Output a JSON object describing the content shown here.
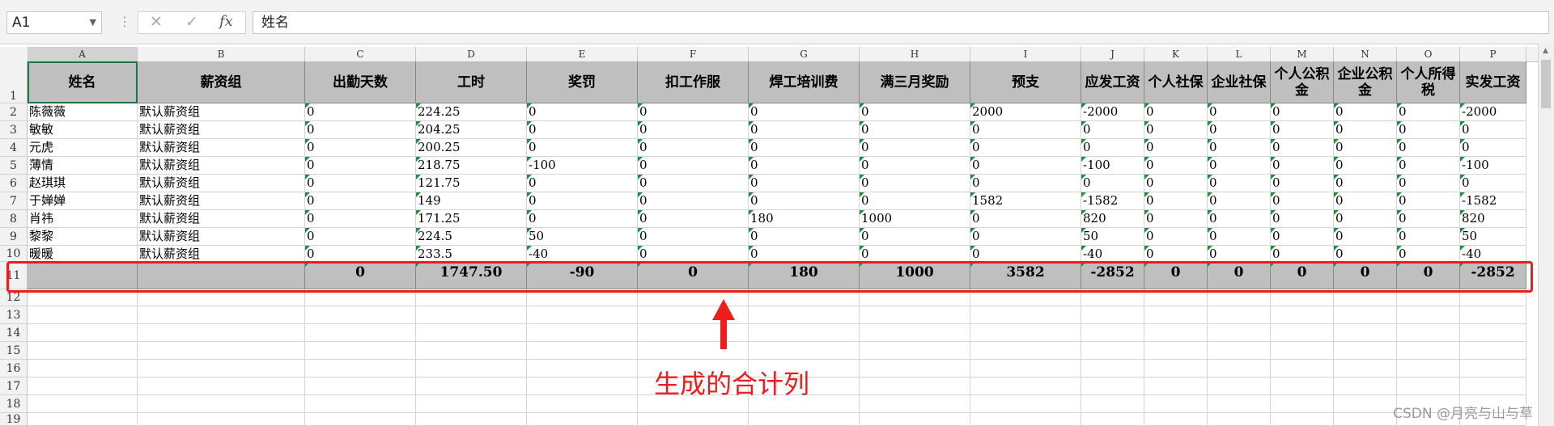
{
  "formula_bar": {
    "name_box": "A1",
    "cancel_icon": "✕",
    "enter_icon": "✓",
    "fx_label": "fx",
    "content": "姓名"
  },
  "columns": [
    "A",
    "B",
    "C",
    "D",
    "E",
    "F",
    "G",
    "H",
    "I",
    "J",
    "K",
    "L",
    "M",
    "N",
    "O",
    "P"
  ],
  "header_row": [
    "姓名",
    "薪资组",
    "出勤天数",
    "工时",
    "奖罚",
    "扣工作服",
    "焊工培训费",
    "满三月奖励",
    "预支",
    "应发工资",
    "个人社保",
    "企业社保",
    "个人公积金",
    "企业公积金",
    "个人所得税",
    "实发工资"
  ],
  "data_rows": [
    [
      "陈薇薇",
      "默认薪资组",
      "0",
      "224.25",
      "0",
      "0",
      "0",
      "0",
      "2000",
      "-2000",
      "0",
      "0",
      "0",
      "0",
      "0",
      "-2000"
    ],
    [
      "敏敏",
      "默认薪资组",
      "0",
      "204.25",
      "0",
      "0",
      "0",
      "0",
      "0",
      "0",
      "0",
      "0",
      "0",
      "0",
      "0",
      "0"
    ],
    [
      "元虎",
      "默认薪资组",
      "0",
      "200.25",
      "0",
      "0",
      "0",
      "0",
      "0",
      "0",
      "0",
      "0",
      "0",
      "0",
      "0",
      "0"
    ],
    [
      "薄情",
      "默认薪资组",
      "0",
      "218.75",
      "-100",
      "0",
      "0",
      "0",
      "0",
      "-100",
      "0",
      "0",
      "0",
      "0",
      "0",
      "-100"
    ],
    [
      "赵琪琪",
      "默认薪资组",
      "0",
      "121.75",
      "0",
      "0",
      "0",
      "0",
      "0",
      "0",
      "0",
      "0",
      "0",
      "0",
      "0",
      "0"
    ],
    [
      "于婵婵",
      "默认薪资组",
      "0",
      "149",
      "0",
      "0",
      "0",
      "0",
      "1582",
      "-1582",
      "0",
      "0",
      "0",
      "0",
      "0",
      "-1582"
    ],
    [
      "肖祎",
      "默认薪资组",
      "0",
      "171.25",
      "0",
      "0",
      "180",
      "1000",
      "0",
      "820",
      "0",
      "0",
      "0",
      "0",
      "0",
      "820"
    ],
    [
      "黎黎",
      "默认薪资组",
      "0",
      "224.5",
      "50",
      "0",
      "0",
      "0",
      "0",
      "50",
      "0",
      "0",
      "0",
      "0",
      "0",
      "50"
    ],
    [
      "暖暖",
      "默认薪资组",
      "0",
      "233.5",
      "-40",
      "0",
      "0",
      "0",
      "0",
      "-40",
      "0",
      "0",
      "0",
      "0",
      "0",
      "-40"
    ]
  ],
  "total_row": [
    "",
    "",
    "0",
    "1747.50",
    "-90",
    "0",
    "180",
    "1000",
    "3582",
    "-2852",
    "0",
    "0",
    "0",
    "0",
    "0",
    "-2852"
  ],
  "row_numbers": [
    "1",
    "2",
    "3",
    "4",
    "5",
    "6",
    "7",
    "8",
    "9",
    "10",
    "11",
    "12",
    "13",
    "14",
    "15",
    "16",
    "17",
    "18",
    "19"
  ],
  "annotation": {
    "text": "生成的合计列",
    "color": "#ef1c1c"
  },
  "watermark": "CSDN @月亮与山与草",
  "colors": {
    "header_fill": "#bfbfbf",
    "selection": "#217346",
    "error_triangle": "#1e8f3e"
  }
}
